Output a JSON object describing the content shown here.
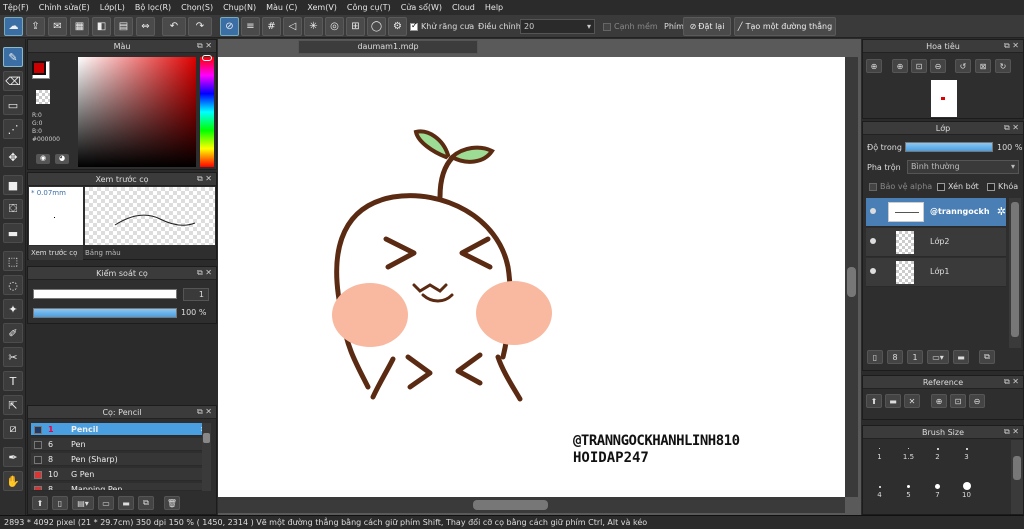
{
  "menu": [
    "Tệp(F)",
    "Chỉnh sửa(E)",
    "Lớp(L)",
    "Bộ lọc(R)",
    "Chọn(S)",
    "Chụp(N)",
    "Màu (C)",
    "Xem(V)",
    "Công cụ(T)",
    "Cửa sổ(W)",
    "Cloud",
    "Help"
  ],
  "toolbar": {
    "antialias": "Khử răng cưa",
    "adjust_label": "Điều chỉnh",
    "adjust_value": "20",
    "smooth_edge": "Cạnh mềm",
    "key_label": "Phím",
    "reset_label": "Đặt lại",
    "line_label": "Tạo một đường thẳng"
  },
  "color_panel": {
    "title": "Màu",
    "r": "R:0",
    "g": "G:0",
    "b": "B:0",
    "hex": "#000000",
    "fg": "#cc0000"
  },
  "brush_preview": {
    "title": "Xem trước cọ",
    "size": "* 0.07mm",
    "tab1": "Xem trước cọ",
    "tab2": "Bảng màu"
  },
  "brush_control": {
    "title": "Kiểm soát cọ",
    "size_value": "1",
    "opacity_value": "100 %"
  },
  "brush_list": {
    "title": "Cọ: Pencil",
    "items": [
      {
        "num": "1",
        "name": "Pencil",
        "color": "#1e3a6a"
      },
      {
        "num": "6",
        "name": "Pen",
        "color": "#333"
      },
      {
        "num": "8",
        "name": "Pen (Sharp)",
        "color": "#333"
      },
      {
        "num": "10",
        "name": "G Pen",
        "color": "#d33"
      },
      {
        "num": "8",
        "name": "Mapping Pen",
        "color": "#d33"
      }
    ]
  },
  "document": {
    "tab": "daumam1.mdp",
    "watermark1": "@TRANNGOCKHANHLINH810",
    "watermark2": "HOIDAP247"
  },
  "navigator": {
    "title": "Hoa tiêu"
  },
  "layers": {
    "title": "Lớp",
    "opacity_label": "Độ trong",
    "opacity_value": "100 %",
    "blend_label": "Pha trộn",
    "blend_value": "Bình thường",
    "protect_alpha": "Bảo vệ alpha",
    "clip": "Xén bớt",
    "lock": "Khóa",
    "items": [
      {
        "name": "@tranngockh"
      },
      {
        "name": "Lớp2"
      },
      {
        "name": "Lớp1"
      }
    ]
  },
  "reference": {
    "title": "Reference"
  },
  "brush_size": {
    "title": "Brush Size",
    "row1": [
      "1",
      "1.5",
      "2",
      "3"
    ],
    "row2": [
      "4",
      "5",
      "7",
      "10"
    ]
  },
  "status": "2893 * 4092 pixel  (21 * 29.7cm)  350 dpi  150 %  ( 1450, 2314 )  Vẽ một đường thẳng bằng cách giữ phím Shift, Thay đổi cỡ cọ bằng cách giữ phím Ctrl, Alt và kéo",
  "colors": {
    "accent": "#3a6ea5",
    "selected": "#4a9fe0",
    "bg": "#2b2b2b"
  }
}
